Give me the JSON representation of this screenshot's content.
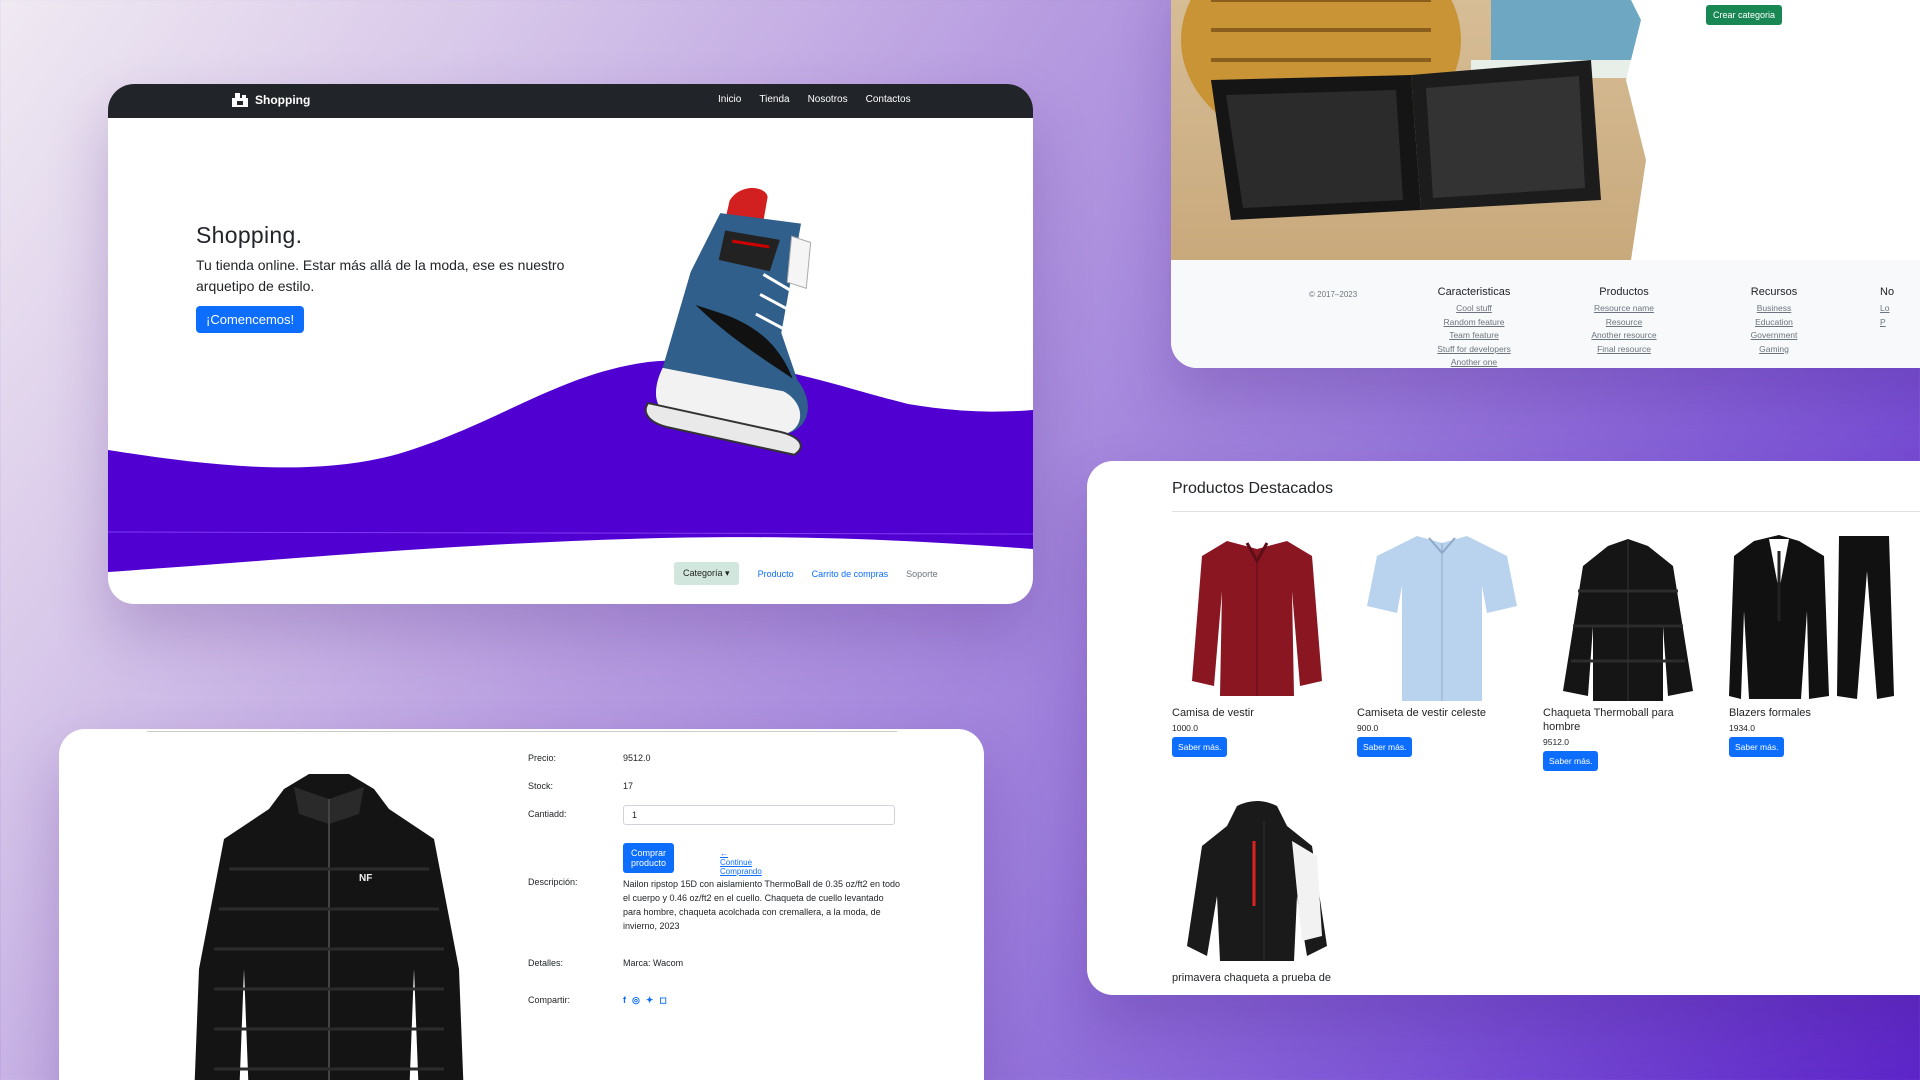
{
  "hero_card": {
    "brand": "Shopping",
    "nav": [
      "Inicio",
      "Tienda",
      "Nosotros",
      "Contactos"
    ],
    "title": "Shopping.",
    "subtitle": "Tu tienda online. Estar más allá de la moda, ese es nuestro arquetipo de estilo.",
    "cta": "¡Comencemos!",
    "subnav": {
      "dropdown": "Categoría",
      "links": [
        "Producto",
        "Carrito de compras",
        "Soporte"
      ]
    },
    "colors": {
      "navbar": "#212529",
      "wave": "#5000d0",
      "primary": "#0d6efd"
    }
  },
  "footer_card": {
    "create_button": "Crear categoria",
    "copyright": "© 2017–2023",
    "columns": [
      {
        "title": "Caracteristicas",
        "links": [
          "Cool stuff",
          "Random feature",
          "Team feature",
          "Stuff for developers",
          "Another one"
        ]
      },
      {
        "title": "Productos",
        "links": [
          "Resource name",
          "Resource",
          "Another resource",
          "Final resource"
        ]
      },
      {
        "title": "Recursos",
        "links": [
          "Business",
          "Education",
          "Government",
          "Gaming"
        ]
      },
      {
        "title": "No",
        "links": [
          "Lo",
          "P"
        ]
      }
    ]
  },
  "detail_card": {
    "price_label": "Precio:",
    "price": "9512.0",
    "stock_label": "Stock:",
    "stock": "17",
    "qty_label": "Cantiadd:",
    "qty": "1",
    "buy_button": "Comprar producto",
    "continue_link": "← Continue Comprando",
    "desc_label": "Descripción:",
    "description": "Nailon ripstop 15D con aislamiento ThermoBall de 0.35 oz/ft2 en todo el cuerpo y 0.46 oz/ft2 en el cuello. Chaqueta de cuello levantado para hombre, chaqueta acolchada con cremallera, a la moda, de invierno, 2023",
    "details_label": "Detalles:",
    "details": "Marca: Wacom",
    "share_label": "Compartir:",
    "share_icons": [
      "facebook-icon",
      "whatsapp-icon",
      "twitter-icon",
      "instagram-icon"
    ]
  },
  "products_card": {
    "title": "Productos Destacados",
    "button_label": "Saber más.",
    "products": [
      {
        "name": "Camisa de vestir",
        "price": "1000.0",
        "color": "#8a1622"
      },
      {
        "name": "Camiseta de vestir celeste",
        "price": "900.0",
        "color": "#b9d2ee"
      },
      {
        "name": "Chaqueta Thermoball para hombre",
        "price": "9512.0",
        "color": "#151515"
      },
      {
        "name": "Blazers formales",
        "price": "1934.0",
        "color": "#111111"
      },
      {
        "name": "primavera chaqueta a prueba de",
        "price": "",
        "color": "#1a1a1a"
      }
    ]
  }
}
